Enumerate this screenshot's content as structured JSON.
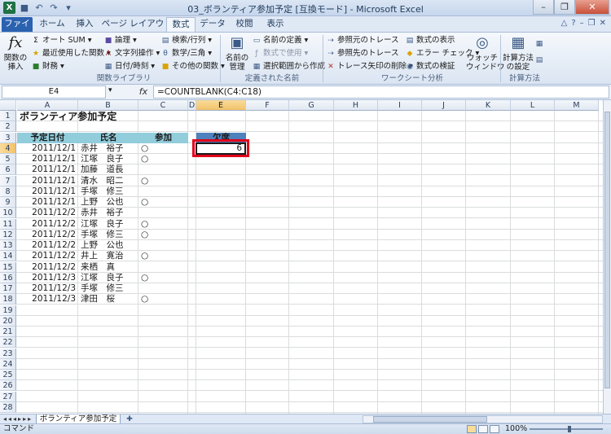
{
  "window": {
    "title": "03_ボランティア参加予定  [互換モード]  -  Microsoft Excel"
  },
  "tabs": [
    "ファイル",
    "ホーム",
    "挿入",
    "ページ レイアウト",
    "数式",
    "データ",
    "校閲",
    "表示"
  ],
  "active_tab": "数式",
  "ribbon": {
    "insert_function": "関数の\n挿入",
    "autosum": "オート SUM",
    "recent": "最近使用した関数",
    "financial": "財務",
    "logical": "論理",
    "text": "文字列操作",
    "datetime": "日付/時刻",
    "lookup": "検索/行列",
    "math": "数学/三角",
    "more": "その他の関数",
    "group_library": "関数ライブラリ",
    "name_manager": "名前の\n管理",
    "define_name": "名前の定義",
    "use_in_formula": "数式で使用",
    "create_from_selection": "選択範囲から作成",
    "group_names": "定義された名前",
    "trace_precedents": "参照元のトレース",
    "trace_dependents": "参照先のトレース",
    "remove_arrows": "トレース矢印の削除",
    "show_formulas": "数式の表示",
    "error_check": "エラー チェック",
    "evaluate": "数式の検証",
    "watch": "ウォッチ\nウィンドウ",
    "group_audit": "ワークシート分析",
    "calc_options": "計算方法\nの設定",
    "group_calc": "計算方法"
  },
  "formula_bar": {
    "name_box": "E4",
    "fx": "fx",
    "formula": "=COUNTBLANK(C4:C18)"
  },
  "columns": [
    "A",
    "B",
    "C",
    "D",
    "E",
    "F",
    "G",
    "H",
    "I",
    "J",
    "K",
    "L",
    "M"
  ],
  "rows": [
    "1",
    "2",
    "3",
    "4",
    "5",
    "6",
    "7",
    "8",
    "9",
    "10",
    "11",
    "12",
    "13",
    "14",
    "15",
    "16",
    "17",
    "18",
    "19",
    "20",
    "21",
    "22",
    "23",
    "24",
    "25",
    "26",
    "27",
    "28"
  ],
  "sheet": {
    "title": "ボランティア参加予定",
    "headers": {
      "date": "予定日付",
      "name": "氏名",
      "attend": "参加",
      "absent": "欠席"
    },
    "absent_value": "6",
    "records": [
      {
        "date": "2011/12/1",
        "name": "赤井　裕子",
        "attend": "○"
      },
      {
        "date": "2011/12/1",
        "name": "江塚　良子",
        "attend": "○"
      },
      {
        "date": "2011/12/1",
        "name": "加藤　道長",
        "attend": ""
      },
      {
        "date": "2011/12/1",
        "name": "清水　昭二",
        "attend": "○"
      },
      {
        "date": "2011/12/1",
        "name": "手塚　修三",
        "attend": ""
      },
      {
        "date": "2011/12/1",
        "name": "上野　公也",
        "attend": "○"
      },
      {
        "date": "2011/12/2",
        "name": "赤井　裕子",
        "attend": ""
      },
      {
        "date": "2011/12/2",
        "name": "江塚　良子",
        "attend": "○"
      },
      {
        "date": "2011/12/2",
        "name": "手塚　修三",
        "attend": "○"
      },
      {
        "date": "2011/12/2",
        "name": "上野　公也",
        "attend": ""
      },
      {
        "date": "2011/12/2",
        "name": "井上　寛治",
        "attend": "○"
      },
      {
        "date": "2011/12/2",
        "name": "来栖　真",
        "attend": ""
      },
      {
        "date": "2011/12/3",
        "name": "江塚　良子",
        "attend": "○"
      },
      {
        "date": "2011/12/3",
        "name": "手塚　修三",
        "attend": ""
      },
      {
        "date": "2011/12/3",
        "name": "津田　桜",
        "attend": "○"
      }
    ]
  },
  "sheet_tab": "ボランティア参加予定",
  "status": {
    "mode": "コマンド",
    "zoom": "100%"
  }
}
